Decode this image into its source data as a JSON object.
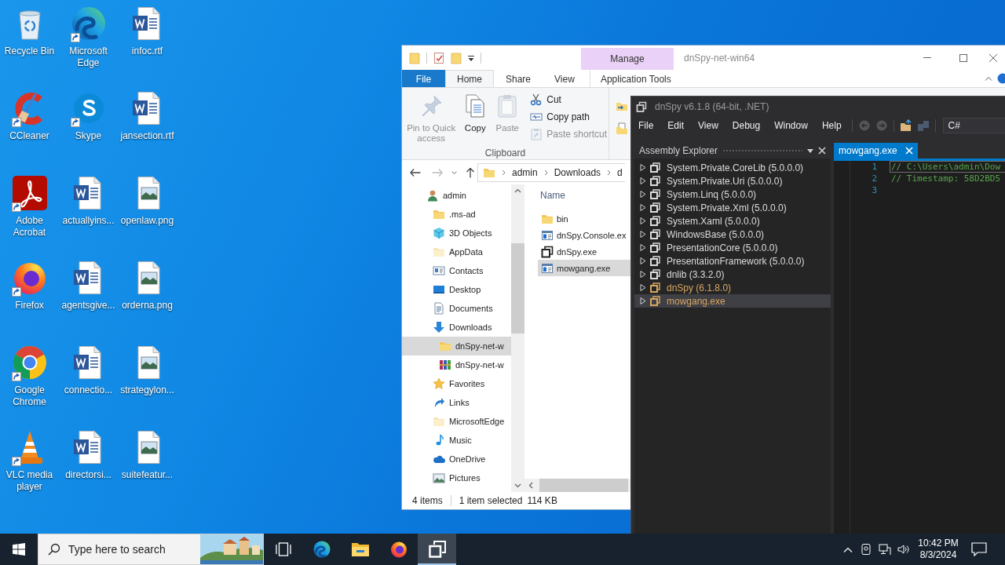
{
  "desktop": {
    "icons": [
      {
        "label": "Recycle Bin",
        "kind": "bin",
        "shortcut": false
      },
      {
        "label": "Microsoft Edge",
        "kind": "edge",
        "shortcut": true
      },
      {
        "label": "infoc.rtf",
        "kind": "word",
        "shortcut": false
      },
      {
        "label": "CCleaner",
        "kind": "ccleaner",
        "shortcut": true
      },
      {
        "label": "Skype",
        "kind": "skype",
        "shortcut": true
      },
      {
        "label": "jansection.rtf",
        "kind": "word",
        "shortcut": false
      },
      {
        "label": "Adobe Acrobat",
        "kind": "acrobat",
        "shortcut": true
      },
      {
        "label": "actuallyins...",
        "kind": "word",
        "shortcut": false
      },
      {
        "label": "openlaw.png",
        "kind": "image",
        "shortcut": false
      },
      {
        "label": "Firefox",
        "kind": "firefox",
        "shortcut": true
      },
      {
        "label": "agentsgive...",
        "kind": "word",
        "shortcut": false
      },
      {
        "label": "orderna.png",
        "kind": "image",
        "shortcut": false
      },
      {
        "label": "Google Chrome",
        "kind": "chrome",
        "shortcut": true
      },
      {
        "label": "connectio...",
        "kind": "word",
        "shortcut": false
      },
      {
        "label": "strategylon...",
        "kind": "image",
        "shortcut": false
      },
      {
        "label": "VLC media player",
        "kind": "vlc",
        "shortcut": true
      },
      {
        "label": "directorsi...",
        "kind": "word",
        "shortcut": false
      },
      {
        "label": "suitefeatur...",
        "kind": "image",
        "shortcut": false
      }
    ]
  },
  "explorer": {
    "context_header": "Manage",
    "title": "dnSpy-net-win64",
    "tabs": [
      {
        "label": "File",
        "kind": "file",
        "selected": false
      },
      {
        "label": "Home",
        "kind": "tab",
        "selected": true
      },
      {
        "label": "Share",
        "kind": "tab",
        "selected": false
      },
      {
        "label": "View",
        "kind": "tab",
        "selected": false
      },
      {
        "label": "Application Tools",
        "kind": "context",
        "selected": false
      }
    ],
    "clipboard": {
      "large_buttons": [
        {
          "label": "Pin to Quick access",
          "kind": "pin",
          "disabled": true
        },
        {
          "label": "Copy",
          "kind": "copy",
          "disabled": false
        },
        {
          "label": "Paste",
          "kind": "paste",
          "disabled": true
        }
      ],
      "small_buttons": [
        {
          "label": "Cut",
          "kind": "cut",
          "disabled": false
        },
        {
          "label": "Copy path",
          "kind": "path",
          "disabled": false
        },
        {
          "label": "Paste shortcut",
          "kind": "shortcut",
          "disabled": true
        }
      ],
      "group_label": "Clipboard"
    },
    "address": {
      "segments": [
        "admin",
        "Downloads",
        "d"
      ]
    },
    "nav_tree": [
      {
        "label": "admin",
        "kind": "user",
        "selected": false,
        "children": [
          {
            "label": ".ms-ad",
            "kind": "folder",
            "selected": false
          },
          {
            "label": "3D Objects",
            "kind": "cube",
            "selected": false
          },
          {
            "label": "AppData",
            "kind": "hidden",
            "selected": false
          },
          {
            "label": "Contacts",
            "kind": "contacts",
            "selected": false
          },
          {
            "label": "Desktop",
            "kind": "desktop",
            "selected": false
          },
          {
            "label": "Documents",
            "kind": "documents",
            "selected": false
          },
          {
            "label": "Downloads",
            "kind": "downloads",
            "selected": false,
            "children": [
              {
                "label": "dnSpy-net-w",
                "kind": "folder",
                "selected": true
              },
              {
                "label": "dnSpy-net-w",
                "kind": "archive",
                "selected": false
              }
            ]
          },
          {
            "label": "Favorites",
            "kind": "star",
            "selected": false
          },
          {
            "label": "Links",
            "kind": "links",
            "selected": false
          },
          {
            "label": "MicrosoftEdge",
            "kind": "hidden",
            "selected": false
          },
          {
            "label": "Music",
            "kind": "music",
            "selected": false
          },
          {
            "label": "OneDrive",
            "kind": "cloud",
            "selected": false
          },
          {
            "label": "Pictures",
            "kind": "pictures",
            "selected": false
          }
        ]
      }
    ],
    "files": {
      "column": "Name",
      "rows": [
        {
          "name": "bin",
          "kind": "folder",
          "selected": false
        },
        {
          "name": "dnSpy.Console.ex",
          "kind": "exe",
          "selected": false
        },
        {
          "name": "dnSpy.exe",
          "kind": "dnspy",
          "selected": false
        },
        {
          "name": "mowgang.exe",
          "kind": "exe",
          "selected": true
        }
      ]
    },
    "status_bar": {
      "count": "4 items",
      "selection": "1 item selected",
      "size": "114 KB"
    }
  },
  "dnspy": {
    "title": "dnSpy v6.1.8 (64-bit, .NET)",
    "menu": [
      "File",
      "Edit",
      "View",
      "Debug",
      "Window",
      "Help"
    ],
    "language": "C#",
    "panel_title": "Assembly Explorer",
    "assemblies": [
      {
        "name": "System.Private.CoreLib (5.0.0.0)",
        "color": "#dcdcdc",
        "expanded": false,
        "selected": false
      },
      {
        "name": "System.Private.Uri (5.0.0.0)",
        "color": "#dcdcdc",
        "expanded": false,
        "selected": false
      },
      {
        "name": "System.Linq (5.0.0.0)",
        "color": "#dcdcdc",
        "expanded": false,
        "selected": false
      },
      {
        "name": "System.Private.Xml (5.0.0.0)",
        "color": "#dcdcdc",
        "expanded": false,
        "selected": false
      },
      {
        "name": "System.Xaml (5.0.0.0)",
        "color": "#dcdcdc",
        "expanded": false,
        "selected": false
      },
      {
        "name": "WindowsBase (5.0.0.0)",
        "color": "#dcdcdc",
        "expanded": false,
        "selected": false
      },
      {
        "name": "PresentationCore (5.0.0.0)",
        "color": "#dcdcdc",
        "expanded": false,
        "selected": false
      },
      {
        "name": "PresentationFramework (5.0.0.0)",
        "color": "#dcdcdc",
        "expanded": false,
        "selected": false
      },
      {
        "name": "dnlib (3.3.2.0)",
        "color": "#dcdcdc",
        "expanded": false,
        "selected": false
      },
      {
        "name": "dnSpy (6.1.8.0)",
        "color": "#d7a660",
        "expanded": false,
        "selected": false
      },
      {
        "name": "mowgang.exe",
        "color": "#d7a660",
        "expanded": false,
        "selected": true
      }
    ],
    "tabs": [
      {
        "label": "mowgang.exe",
        "selected": true
      }
    ],
    "code": [
      {
        "number": "1",
        "text": "// C:\\Users\\admin\\Dow",
        "current": true
      },
      {
        "number": "2",
        "text": "// Timestamp: 58D2BD5",
        "current": false
      },
      {
        "number": "3"
      }
    ]
  },
  "taskbar": {
    "search": {
      "placeholder": "Type here to search"
    },
    "apps": [
      {
        "kind": "taskview",
        "selected": false
      },
      {
        "kind": "edge",
        "selected": false
      },
      {
        "kind": "explorer",
        "selected": false
      },
      {
        "kind": "firefox",
        "selected": false
      },
      {
        "kind": "dnspy",
        "selected": true
      }
    ],
    "clock": {
      "time": "10:42 PM",
      "date": "8/3/2024"
    }
  }
}
